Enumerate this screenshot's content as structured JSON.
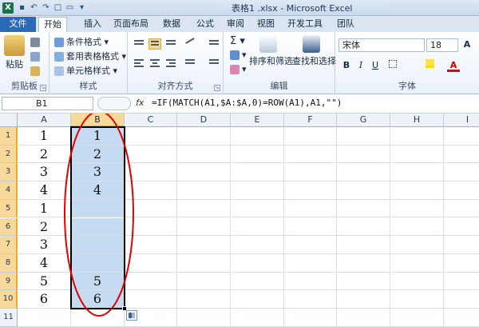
{
  "window": {
    "title": "表格1 .xlsx - Microsoft Excel",
    "app_icon": "X"
  },
  "tabs": [
    "文件",
    "开始",
    "插入",
    "页面布局",
    "数据",
    "公式",
    "审阅",
    "视图",
    "开发工具",
    "团队"
  ],
  "ribbon": {
    "clipboard": {
      "label": "剪贴板",
      "paste": "粘贴"
    },
    "styles": {
      "label": "样式",
      "cond_format": "条件格式",
      "table_format": "套用表格格式",
      "cell_styles": "单元格样式"
    },
    "alignment": {
      "label": "对齐方式"
    },
    "editing": {
      "label": "编辑",
      "sort_filter": "排序和筛选",
      "find_select": "查找和选择"
    },
    "font": {
      "label": "字体",
      "name": "宋体",
      "size": "18",
      "bold": "B",
      "italic": "I",
      "underline": "U",
      "grow": "A",
      "shrink": "A"
    }
  },
  "formula_bar": {
    "name_box": "B1",
    "fx": "fx",
    "formula": "=IF(MATCH(A1,$A:$A,0)=ROW(A1),A1,\"\")"
  },
  "sheet": {
    "columns": [
      "A",
      "B",
      "C",
      "D",
      "E",
      "F",
      "G",
      "H",
      "I"
    ],
    "rows": [
      "1",
      "2",
      "3",
      "4",
      "5",
      "6",
      "7",
      "8",
      "9",
      "10",
      "11"
    ],
    "col_a": [
      "1",
      "2",
      "3",
      "4",
      "1",
      "2",
      "3",
      "4",
      "5",
      "6",
      ""
    ],
    "col_b": [
      "1",
      "2",
      "3",
      "4",
      "",
      "",
      "",
      "",
      "5",
      "6",
      ""
    ],
    "selected_column": "B",
    "selected_rows": "1-10"
  },
  "colors": {
    "selection_fill": "#c5dbf2",
    "header_selected": "#f9d99a",
    "annotation_ellipse": "#e00000",
    "file_tab": "#2a6ab6"
  }
}
